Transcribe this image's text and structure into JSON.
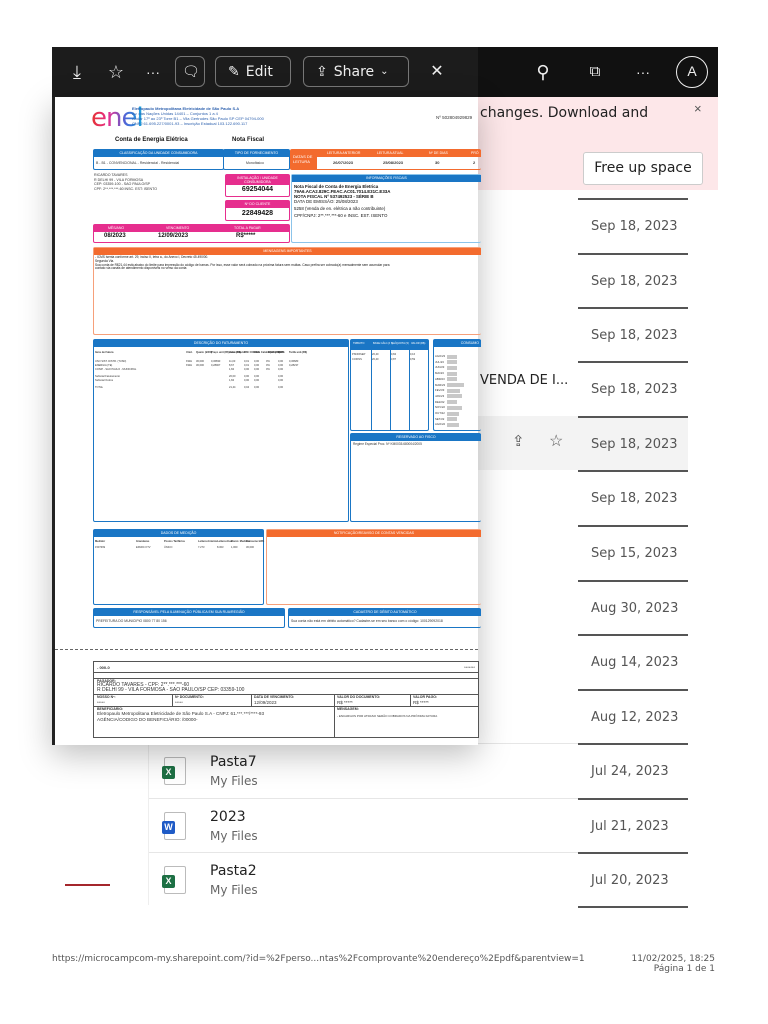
{
  "toolbar": {
    "download_icon": "download-icon",
    "favorite_icon": "star-icon",
    "more_label": "···",
    "comment_icon": "comment-icon",
    "edit_label": "Edit",
    "share_label": "Share",
    "close_label": "✕",
    "avatar_initial": "A",
    "right_more_label": "···"
  },
  "banner": {
    "message": "changes. Download and",
    "close": "×",
    "free_up_space": "Free up space"
  },
  "list": {
    "truncated_name": "VENDA DE I...",
    "dates": [
      "Sep 18, 2023",
      "Sep 18, 2023",
      "Sep 18, 2023",
      "Sep 18, 2023",
      "Sep 18, 2023",
      "Sep 18, 2023",
      "Sep 15, 2023",
      "Aug 30, 2023",
      "Aug 14, 2023",
      "Aug 12, 2023",
      "Jul 24, 2023",
      "Jul 21, 2023",
      "Jul 20, 2023"
    ],
    "files": [
      {
        "name": "Pasta7",
        "location": "My Files",
        "type": "excel"
      },
      {
        "name": "2023",
        "location": "My Files",
        "type": "word"
      },
      {
        "name": "Pasta2",
        "location": "My Files",
        "type": "excel"
      }
    ]
  },
  "document": {
    "company": [
      "Eletropaulo Metropolitana Eletricidade de São Paulo S.A",
      "Av. das Nações Unidas 14401 – Conjuntos 1 a 4",
      "Andar 17º ao 23º Torre B1 – Vila Gertrudes São Paulo SP CEP 04794-000",
      "CNPJ 61.695.227/0001-93 – Inscrição Estadual 103.122.690.117"
    ],
    "numero": "Nº 502804929829",
    "title": "Conta de Energia Elétrica",
    "nota_fiscal": "Nota Fiscal",
    "classificacao_header": "CLASSIFICAÇÃO DA UNIDADE CONSUMIDORA",
    "classificacao": "B - B1 - CONVENCIONAL - Residencial - Residencial",
    "tipo_header": "TIPO DE FORNECIMENTO",
    "tipo": "Monofásico",
    "datas_label": "DATAS DE LEITURA",
    "leitura_headers": [
      "LEITURA ANTERIOR",
      "LEITURA ATUAL",
      "Nº DE DIAS",
      "PRÓ"
    ],
    "leitura_values": [
      "26/07/2023",
      "25/08/2023",
      "30",
      "2"
    ],
    "cliente": [
      "RICARDO TAVARES",
      "R DELHI 99 - VILA FORMOSA",
      "CEP: 03359-100 - SAO PAULO/SP",
      "CPF: 2**.***.***-60 INSC. EST: ISENTO"
    ],
    "instalacao_header": "INSTALAÇÃO / UNIDADE CONSUMIDORA",
    "instalacao": "69254044",
    "cliente_header": "Nº DO CLIENTE",
    "cliente_num": "22849428",
    "mes_header": "MÊS/ANO",
    "mes": "08/2023",
    "venc_header": "VENCIMENTO",
    "venc": "12/09/2023",
    "total_header": "TOTAL A PAGAR",
    "total": "R$*****",
    "fiscais_header": "INFORMAÇÕES FISCAIS",
    "fiscais": [
      "Nota Fiscal de Conta de Energia Eletrica",
      "79A6.ACA2.829C.FEAC.AC01.7014.E31C.E33A",
      "NOTA FISCAL Nº 537492523 - SÉRIE B",
      "DATA DE EMISSÃO: 25/08/2023",
      "5258 (Venda de en. elétrica a não contribuinte)",
      "CPF/CNPJ:  2**.***.***-60 e INSC. EST. ISENTO"
    ],
    "mensagens_header": "MENSAGENS IMPORTANTES",
    "mensagens": [
      "- ICMS isenta conforme art. 29, inciso II, letra a., do Anexo I, Decreto 45.490/00.",
      "Segunda Via.",
      "Sua conta de R$21,44 está abaixo do limite para impressão do código de barras. Por isso, esse valor será cobrado na próxima fatura sem multas. Caso prefira ser cobrado(a) mensalmente sem acumular para",
      "contato via canais de atendimento disponíveis no verso da conta"
    ],
    "faturamento_header": "DESCRIÇÃO DO FATURAMENTO",
    "fat_cols": [
      "Itens de Fatura",
      "Unid.",
      "Quant. (kWh)",
      "Preço unit (R$) com tributos",
      "Valor (R$)",
      "PIS/ COFINS",
      "Base Calc. ICMS (R$)",
      "Alíquota ICMS",
      "ICMS",
      "Tarifa unit.(R$)"
    ],
    "fat_rows": [
      [
        "USO SIST. DISTR. (TUSD)",
        "KWH",
        "30,000",
        "0,36833",
        "11,03",
        "0,01",
        "0,00",
        "0%",
        "0,00",
        "0,36683"
      ],
      [
        "ENERGIA (TE)",
        "KWH",
        "30,000",
        "0,28907",
        "8,67",
        "0,01",
        "0,00",
        "0%",
        "0,00",
        "0,28237"
      ],
      [
        "COSIP - SAO PAULO - MUNICIPAL",
        "",
        "",
        "",
        "1,84",
        "0,00",
        "0,00",
        "0%",
        "0,00",
        ""
      ],
      [
        "Subtotal Faturamento",
        "",
        "",
        "",
        "20,00",
        "0,00",
        "0,00",
        "",
        "0,00",
        ""
      ],
      [
        "Subtotal Outros",
        "",
        "",
        "",
        "1,84",
        "0,00",
        "0,00",
        "",
        "0,00",
        ""
      ],
      [
        "TOTAL",
        "",
        "",
        "",
        "21,44",
        "0,04",
        "0,00",
        "",
        "0,00",
        ""
      ]
    ],
    "tributos_cols": [
      "TRIBUTO",
      "BASE CÁLC.(R$)",
      "ALÍQUOTA (%)",
      "VALOR (R$)"
    ],
    "tributos_rows": [
      [
        "PIS/PASEP",
        "20,40",
        "0,84",
        "0,16"
      ],
      [
        "COFINS",
        "20,40",
        "3,87",
        "0,59"
      ]
    ],
    "consumo_header": "CONSUMO",
    "consumo_months": [
      "AGO/23",
      "JUL/23",
      "JUN/23",
      "MAI/23",
      "ABR/23",
      "MAR/23",
      "FEV/23",
      "JAN/23",
      "DEZ/22",
      "NOV/22",
      "OUT/22",
      "SET/22",
      "AGO/22"
    ],
    "consumo_values": [
      30,
      30,
      30,
      30,
      30,
      50,
      40,
      45,
      30,
      45,
      35,
      30,
      35
    ],
    "fisco_header": "RESERVADO AO FISCO",
    "fisco": "Regime Especial Proc. Nº KM0035.680004/2005",
    "medicao_header": "DADOS DE MEDIÇÃO",
    "medicao_cols": [
      "Medidor",
      "Grandezas",
      "Postos Tarifários",
      "Leitura Anterior",
      "Leitura Atual",
      "Const. Medidor",
      "Consumo kWh"
    ],
    "medicao_row": [
      "1507369",
      "EPARC KTV",
      "ÚNICO",
      "7.273",
      "8.303",
      "1,000",
      "30,000"
    ],
    "notificacao_header": "NOTIFICAÇÃO/REAVISO DE CONTAS VENCIDAS",
    "iluminacao_header": "RESPONSÁVEL PELA ILUMINAÇÃO PÚBLICA EM SUA RUA/REGIÃO",
    "iluminacao": "PREFEITURA DO MUNICIPIO 0800 77 80 156",
    "debito_header": "CADASTRO DE DÉBITO AUTOMÁTICO",
    "debito": "Sua conta não está em débito automático? Cadastre-se em seu banco com o código: 100129092018",
    "boleto": {
      "banco": "- 000-0",
      "linha": "*******",
      "pagador_label": "PAGADOR:",
      "pagador": "RICARDO TAVARES - CPF: 2**.***.***-60",
      "endereco": "R DELHI 99 - VILA FORMOSA - SAO PAULO/SP CEP: 03359-100",
      "nosso_label": "NOSSO Nº:",
      "nosso": "*****",
      "doc_label": "Nº DOCUMENTO:",
      "doc": "*****",
      "venc_label": "DATA DE VENCIMENTO:",
      "venc": "12/09/2023",
      "valor_label": "VALOR DO DOCUMENTO:",
      "valor": "R$ *****",
      "pago_label": "VALOR PAGO:",
      "pago": "R$ *****",
      "benef_label": "BENEFICIÁRIO:",
      "benef": "Eletropaulo Metropolitana Eletricidade de São Paulo S.A - CNPJ: 61.***.***/****-93",
      "agencia": "AGÊNCIA/CODIGO DO BENEFICIÁRIO: /00000-",
      "mensagem_label": "MENSAGEM:",
      "mensagem": "- ENCARGOS POR ATRASO SERÃO COBRADOS NA PRÓXIMA FATURA"
    }
  },
  "footer": {
    "url": "https://microcampcom-my.sharepoint.com/?id=%2Fperso...ntas%2Fcomprovante%20endereço%2Epdf&parentview=1",
    "datetime": "11/02/2025, 18:25",
    "page": "Página 1 de 1"
  }
}
